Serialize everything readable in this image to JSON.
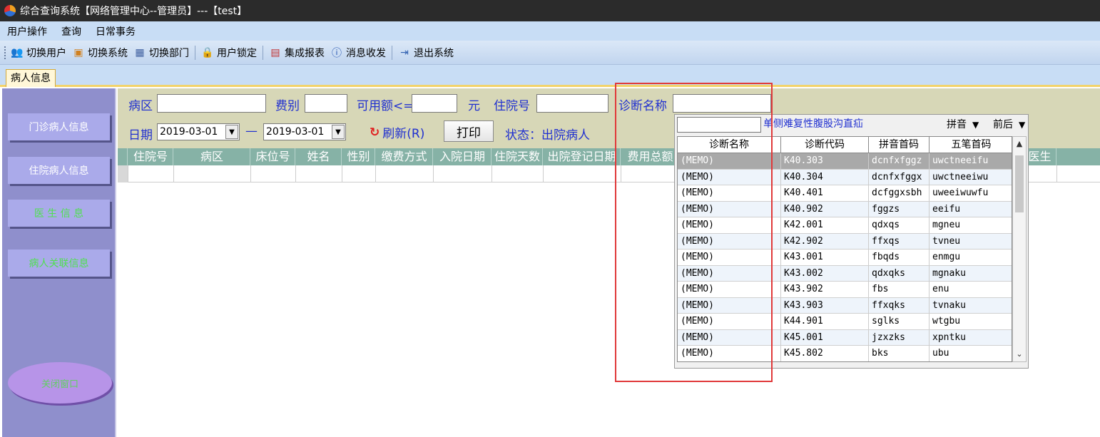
{
  "window": {
    "title": "综合查询系统【网络管理中心--管理员】---【test】"
  },
  "menu": [
    {
      "label": "用户操作"
    },
    {
      "label": "查询"
    },
    {
      "label": "日常事务"
    }
  ],
  "toolbar": [
    {
      "label": "切换用户",
      "icon": "switch-user-icon"
    },
    {
      "label": "切换系统",
      "icon": "switch-system-icon"
    },
    {
      "label": "切换部门",
      "icon": "switch-department-icon"
    },
    {
      "label": "用户锁定",
      "icon": "user-lock-icon"
    },
    {
      "label": "集成报表",
      "icon": "report-icon"
    },
    {
      "label": "消息收发",
      "icon": "message-icon"
    },
    {
      "label": "退出系统",
      "icon": "exit-icon"
    }
  ],
  "tabs": [
    {
      "label": "病人信息"
    }
  ],
  "sidebar": {
    "buttons": [
      {
        "label": "门诊病人信息"
      },
      {
        "label": "住院病人信息"
      },
      {
        "label": "医 生 信 息"
      },
      {
        "label": "病人关联信息"
      }
    ],
    "close_label": "关闭窗口"
  },
  "filter": {
    "ward_label": "病区",
    "fee_type_label": "费别",
    "available_label": "可用额<=",
    "currency_label": "元",
    "inpatient_no_label": "住院号",
    "diagnosis_label": "诊断名称",
    "date_label": "日期",
    "date_from": "2019-03-01",
    "date_dash": "—",
    "date_to": "2019-03-01",
    "refresh_label": "刷新(R)",
    "print_label": "打印",
    "status_text": "状态：出院病人"
  },
  "grid": {
    "columns": [
      "住院号",
      "病区",
      "床位号",
      "姓名",
      "性别",
      "缴费方式",
      "入院日期",
      "住院天数",
      "出院登记日期",
      "费用总额",
      "医生"
    ]
  },
  "diagnosis_popup": {
    "selected_name": "单侧难复性腹股沟直疝",
    "mode_select": "拼音",
    "position_select": "前后",
    "columns": [
      "诊断名称",
      "诊断代码",
      "拼音首码",
      "五笔首码"
    ],
    "rows": [
      {
        "name": "(MEMO)",
        "code": "K40.303",
        "pinyin": "dcnfxfggz",
        "wubi": "uwctneeifu"
      },
      {
        "name": "(MEMO)",
        "code": "K40.304",
        "pinyin": "dcnfxfggx",
        "wubi": "uwctneeiwu"
      },
      {
        "name": "(MEMO)",
        "code": "K40.401",
        "pinyin": "dcfggxsbh",
        "wubi": "uweeiwuwfu"
      },
      {
        "name": "(MEMO)",
        "code": "K40.902",
        "pinyin": "fggzs",
        "wubi": "eeifu"
      },
      {
        "name": "(MEMO)",
        "code": "K42.001",
        "pinyin": "qdxqs",
        "wubi": "mgneu"
      },
      {
        "name": "(MEMO)",
        "code": "K42.902",
        "pinyin": "ffxqs",
        "wubi": "tvneu"
      },
      {
        "name": "(MEMO)",
        "code": "K43.001",
        "pinyin": "fbqds",
        "wubi": "enmgu"
      },
      {
        "name": "(MEMO)",
        "code": "K43.002",
        "pinyin": "qdxqks",
        "wubi": "mgnaku"
      },
      {
        "name": "(MEMO)",
        "code": "K43.902",
        "pinyin": "fbs",
        "wubi": "enu"
      },
      {
        "name": "(MEMO)",
        "code": "K43.903",
        "pinyin": "ffxqks",
        "wubi": "tvnaku"
      },
      {
        "name": "(MEMO)",
        "code": "K44.901",
        "pinyin": "sglks",
        "wubi": "wtgbu"
      },
      {
        "name": "(MEMO)",
        "code": "K45.001",
        "pinyin": "jzxzks",
        "wubi": "xpntku"
      },
      {
        "name": "(MEMO)",
        "code": "K45.802",
        "pinyin": "bks",
        "wubi": "ubu"
      }
    ]
  },
  "colors": {
    "highlight": "#e0393a",
    "label_blue": "#2030d0",
    "sidebar": "#8f8fcc"
  }
}
